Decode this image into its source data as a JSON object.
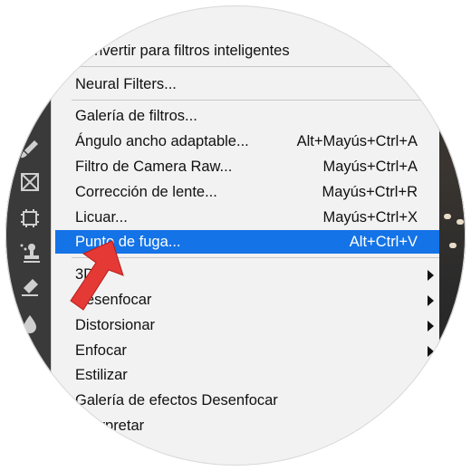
{
  "menu": {
    "items": [
      {
        "label": "Convertir para filtros inteligentes",
        "shortcut": "",
        "submenu": false,
        "selected": false
      },
      {
        "label": "Neural Filters...",
        "shortcut": "",
        "submenu": false,
        "selected": false
      },
      {
        "label": "Galería de filtros...",
        "shortcut": "",
        "submenu": false,
        "selected": false
      },
      {
        "label": "Ángulo ancho adaptable...",
        "shortcut": "Alt+Mayús+Ctrl+A",
        "submenu": false,
        "selected": false
      },
      {
        "label": "Filtro de Camera Raw...",
        "shortcut": "Mayús+Ctrl+A",
        "submenu": false,
        "selected": false
      },
      {
        "label": "Corrección de lente...",
        "shortcut": "Mayús+Ctrl+R",
        "submenu": false,
        "selected": false
      },
      {
        "label": "Licuar...",
        "shortcut": "Mayús+Ctrl+X",
        "submenu": false,
        "selected": false
      },
      {
        "label": "Punto de fuga...",
        "shortcut": "Alt+Ctrl+V",
        "submenu": false,
        "selected": true
      },
      {
        "label": "3D",
        "shortcut": "",
        "submenu": true,
        "selected": false
      },
      {
        "label": "Desenfocar",
        "shortcut": "",
        "submenu": true,
        "selected": false
      },
      {
        "label": "Distorsionar",
        "shortcut": "",
        "submenu": true,
        "selected": false
      },
      {
        "label": "Enfocar",
        "shortcut": "",
        "submenu": true,
        "selected": false
      },
      {
        "label": "Estilizar",
        "shortcut": "",
        "submenu": true,
        "selected": false
      },
      {
        "label": "Galería de efectos Desenfocar",
        "shortcut": "",
        "submenu": true,
        "selected": false
      },
      {
        "label": "Interpretar",
        "shortcut": "",
        "submenu": true,
        "selected": false
      }
    ]
  },
  "toolbar": {
    "icons": [
      "brush-icon",
      "frame-icon",
      "crop-icon",
      "stamp-icon",
      "eraser-icon",
      "drop-icon"
    ]
  },
  "colors": {
    "selection": "#1473e6",
    "menu_bg": "#f2f2f2",
    "toolbar_bg": "#3a3a3a",
    "pointer": "#e53935"
  }
}
